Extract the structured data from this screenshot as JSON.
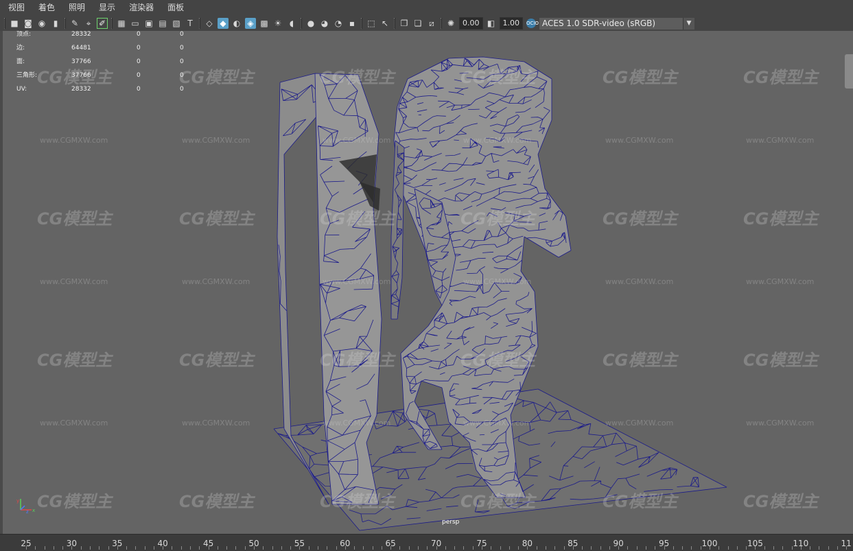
{
  "menu": [
    "视图",
    "着色",
    "照明",
    "显示",
    "渲染器",
    "面板"
  ],
  "toolbar": {
    "exposure": "0.00",
    "gamma": "1.00",
    "cm_badge": "OCIO",
    "color_management": "ACES 1.0 SDR-video (sRGB)"
  },
  "hud": [
    {
      "label": "顶点:",
      "v1": "28332",
      "v2": "0",
      "v3": "0"
    },
    {
      "label": "边:",
      "v1": "64481",
      "v2": "0",
      "v3": "0"
    },
    {
      "label": "面:",
      "v1": "37766",
      "v2": "0",
      "v3": "0"
    },
    {
      "label": "三角形:",
      "v1": "37766",
      "v2": "0",
      "v3": "0"
    },
    {
      "label": "UV:",
      "v1": "28332",
      "v2": "0",
      "v3": "0"
    }
  ],
  "camera_label": "persp",
  "watermark": {
    "logo": "CG模型主",
    "url": "www.CGMXW.com"
  },
  "timeline": [
    "25",
    "30",
    "35",
    "40",
    "45",
    "50",
    "55",
    "60",
    "65",
    "70",
    "75",
    "80",
    "85",
    "90",
    "95",
    "100",
    "105",
    "110",
    "11"
  ],
  "colors": {
    "viewport_bg": "#646464",
    "wire": "#1a1a8a",
    "mesh_fill": "#8c8c8c"
  }
}
